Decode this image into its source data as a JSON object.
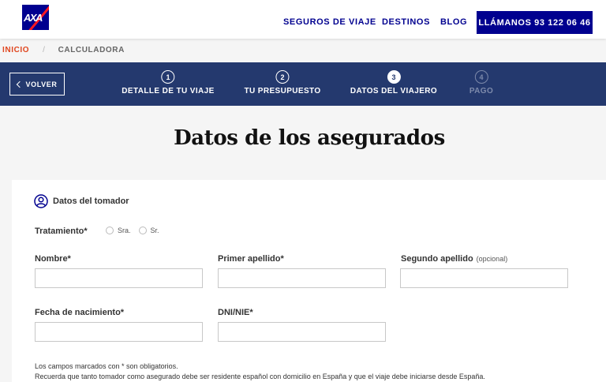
{
  "header": {
    "logo_text": "AXA",
    "nav": [
      "SEGUROS DE VIAJE",
      "DESTINOS",
      "BLOG"
    ],
    "call_button": "LLÁMANOS 93 122 06 46"
  },
  "breadcrumb": {
    "home": "INICIO",
    "separator": "/",
    "current": "CALCULADORA"
  },
  "steps_bar": {
    "back_label": "VOLVER",
    "steps": [
      {
        "num": "1",
        "label": "DETALLE DE TU VIAJE",
        "state": "done"
      },
      {
        "num": "2",
        "label": "TU PRESUPUESTO",
        "state": "done"
      },
      {
        "num": "3",
        "label": "DATOS DEL VIAJERO",
        "state": "active"
      },
      {
        "num": "4",
        "label": "PAGO",
        "state": "disabled"
      }
    ]
  },
  "page_title": "Datos de los asegurados",
  "form": {
    "section_title": "Datos del tomador",
    "tratamiento_label": "Tratamiento*",
    "tratamiento_options": [
      "Sra.",
      "Sr."
    ],
    "nombre_label": "Nombre*",
    "primer_apellido_label": "Primer apellido*",
    "segundo_apellido_label": "Segundo apellido",
    "segundo_apellido_optional": "(opcional)",
    "fecha_label": "Fecha de nacimiento*",
    "dni_label": "DNI/NIE*",
    "note_required": "Los campos marcados con * son obligatorios.",
    "note_residency": "Recuerda que tanto tomador como asegurado debe ser residente español con domicilio en España y que el viaje debe iniciarse desde España."
  },
  "colors": {
    "brand_blue": "#00008f",
    "step_bar": "#24396e",
    "breadcrumb_home": "#e0461f",
    "axa_red": "#ff1721"
  }
}
